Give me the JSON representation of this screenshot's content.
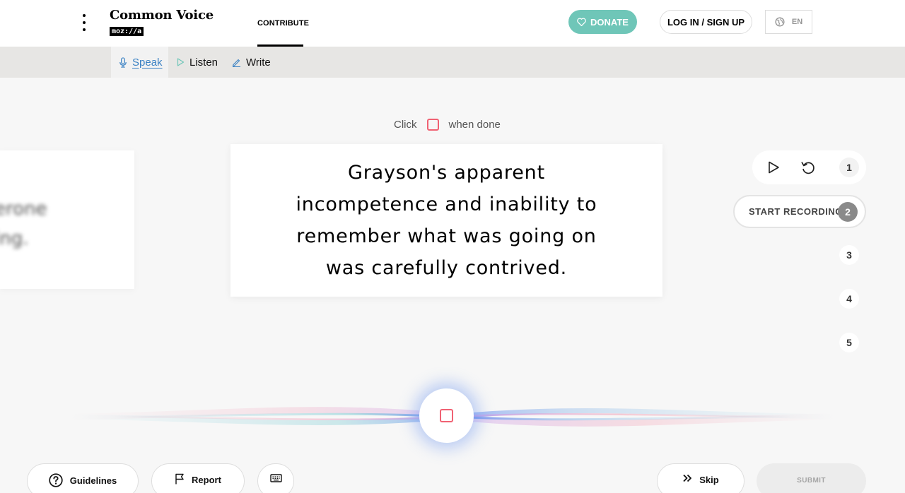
{
  "header": {
    "logo_title": "Common Voice",
    "logo_sub": "moz://a",
    "nav": {
      "contribute": "CONTRIBUTE"
    },
    "donate_label": "DONATE",
    "login_label": "LOG IN / SIGN UP",
    "language": "EN"
  },
  "subnav": {
    "items": [
      {
        "label": "Speak",
        "icon": "mic-icon",
        "active": true
      },
      {
        "label": "Listen",
        "icon": "play-outline-icon",
        "active": false
      },
      {
        "label": "Write",
        "icon": "pencil-icon",
        "active": false
      }
    ]
  },
  "instruction": {
    "before": "Click",
    "after": "when done"
  },
  "ghost_card": {
    "text_lines": [
      "erone",
      "ing."
    ]
  },
  "sentence": "Grayson's apparent incompetence and inability to remember what was going on was carefully contrived.",
  "clips": {
    "start_recording_label": "START RECORDING",
    "numbers": [
      "1",
      "2",
      "3",
      "4",
      "5"
    ]
  },
  "bottom": {
    "guidelines_label": "Guidelines",
    "report_label": "Report",
    "skip_label": "Skip",
    "submit_label": "SUBMIT"
  },
  "colors": {
    "accent": "#3b82c4",
    "donate": "#6fc6b8",
    "record_red": "#f06273"
  }
}
